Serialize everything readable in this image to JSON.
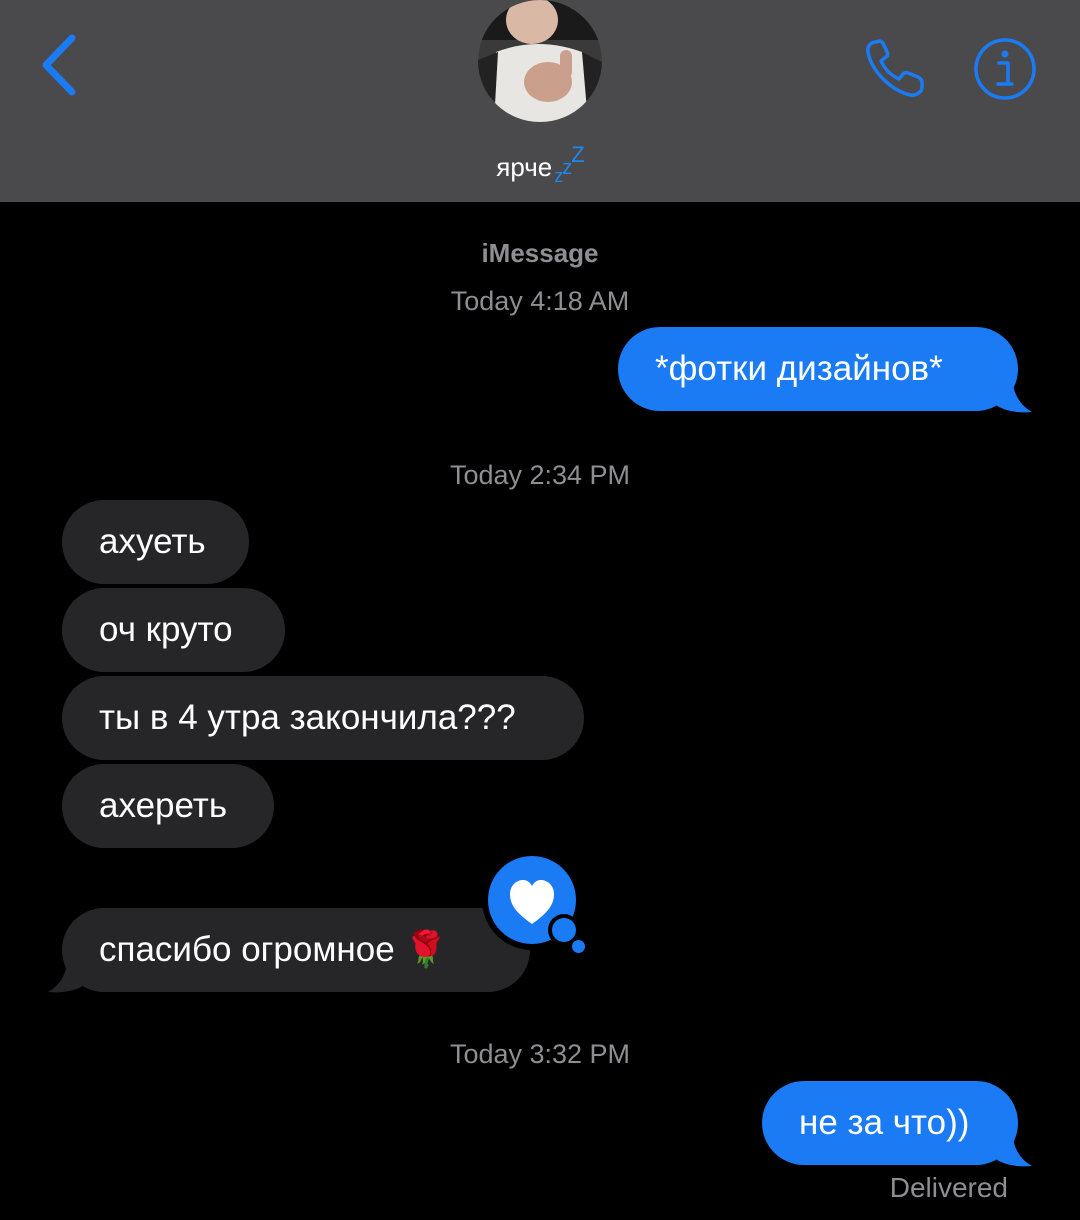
{
  "header": {
    "contact_name": "ярче",
    "contact_status": "zzZ",
    "back_icon": "chevron-left-icon",
    "call_icon": "phone-icon",
    "info_icon": "info-icon",
    "accent_color": "#1b7bf5"
  },
  "conversation": {
    "service_label": "iMessage",
    "timestamps": [
      "Today 4:18 AM",
      "Today 2:34 PM",
      "Today 3:32 PM"
    ],
    "messages": [
      {
        "direction": "outgoing",
        "text": "*фотки дизайнов*"
      },
      {
        "direction": "incoming",
        "text": "ахуеть"
      },
      {
        "direction": "incoming",
        "text": "оч круто"
      },
      {
        "direction": "incoming",
        "text": "ты в 4 утра закончила???"
      },
      {
        "direction": "incoming",
        "text": "ахереть"
      },
      {
        "direction": "incoming",
        "text": "спасибо огромное 🌹",
        "reaction": "heart-icon"
      },
      {
        "direction": "outgoing",
        "text": "не за что))"
      }
    ],
    "delivery_status": "Delivered"
  }
}
